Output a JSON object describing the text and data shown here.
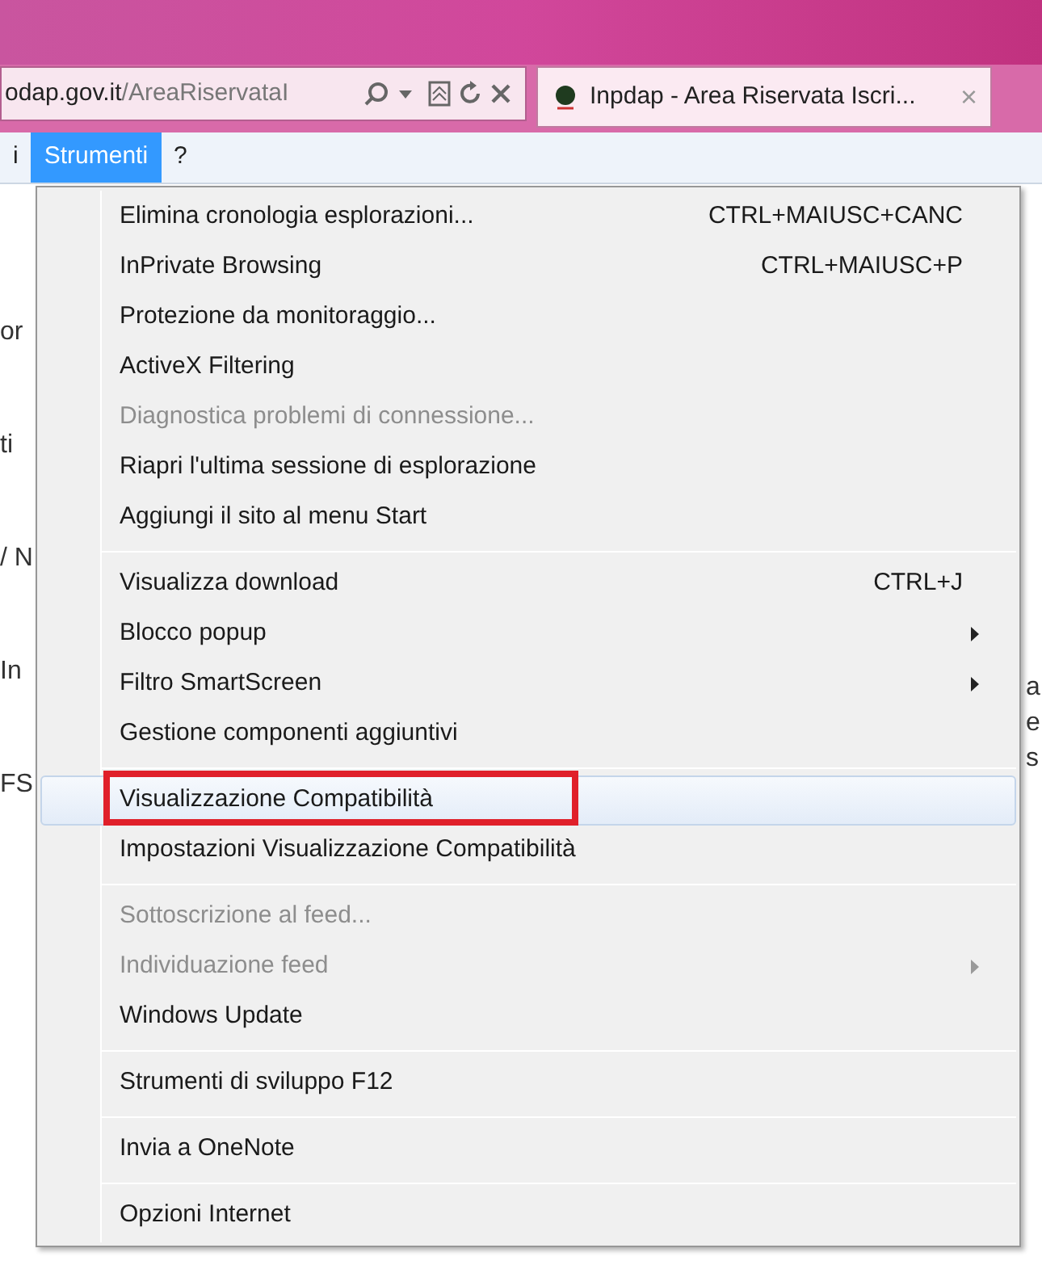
{
  "address_bar": {
    "host": "odap.gov.it",
    "path": "/AreaRiservataI"
  },
  "tab": {
    "title": "Inpdap - Area Riservata Iscri...",
    "close": "×"
  },
  "menubar": [
    {
      "label": "i",
      "selected": false
    },
    {
      "label": "Strumenti",
      "selected": true
    },
    {
      "label": "?",
      "selected": false
    }
  ],
  "page_fragments_left": [
    "or",
    "ti",
    "/ N",
    "In",
    "FS"
  ],
  "page_fragments_right": [
    "a",
    "e",
    "s"
  ],
  "menu": [
    {
      "kind": "item",
      "label": "Elimina cronologia esplorazioni...",
      "shortcut": "CTRL+MAIUSC+CANC",
      "disabled": false,
      "submenu": false,
      "selected": false,
      "annotated": false
    },
    {
      "kind": "item",
      "label": "InPrivate Browsing",
      "shortcut": "CTRL+MAIUSC+P",
      "disabled": false,
      "submenu": false,
      "selected": false,
      "annotated": false
    },
    {
      "kind": "item",
      "label": "Protezione da monitoraggio...",
      "disabled": false,
      "submenu": false,
      "selected": false,
      "annotated": false
    },
    {
      "kind": "item",
      "label": "ActiveX Filtering",
      "disabled": false,
      "submenu": false,
      "selected": false,
      "annotated": false
    },
    {
      "kind": "item",
      "label": "Diagnostica problemi di connessione...",
      "disabled": true,
      "submenu": false,
      "selected": false,
      "annotated": false
    },
    {
      "kind": "item",
      "label": "Riapri l'ultima sessione di esplorazione",
      "disabled": false,
      "submenu": false,
      "selected": false,
      "annotated": false
    },
    {
      "kind": "item",
      "label": "Aggiungi il sito al menu Start",
      "disabled": false,
      "submenu": false,
      "selected": false,
      "annotated": false
    },
    {
      "kind": "separator"
    },
    {
      "kind": "item",
      "label": "Visualizza download",
      "shortcut": "CTRL+J",
      "disabled": false,
      "submenu": false,
      "selected": false,
      "annotated": false
    },
    {
      "kind": "item",
      "label": "Blocco popup",
      "disabled": false,
      "submenu": true,
      "selected": false,
      "annotated": false
    },
    {
      "kind": "item",
      "label": "Filtro SmartScreen",
      "disabled": false,
      "submenu": true,
      "selected": false,
      "annotated": false
    },
    {
      "kind": "item",
      "label": "Gestione componenti aggiuntivi",
      "disabled": false,
      "submenu": false,
      "selected": false,
      "annotated": false
    },
    {
      "kind": "separator"
    },
    {
      "kind": "item",
      "label": "Visualizzazione Compatibilità",
      "disabled": false,
      "submenu": false,
      "selected": true,
      "annotated": true
    },
    {
      "kind": "item",
      "label": "Impostazioni Visualizzazione Compatibilità",
      "disabled": false,
      "submenu": false,
      "selected": false,
      "annotated": false
    },
    {
      "kind": "separator"
    },
    {
      "kind": "item",
      "label": "Sottoscrizione al feed...",
      "disabled": true,
      "submenu": false,
      "selected": false,
      "annotated": false
    },
    {
      "kind": "item",
      "label": "Individuazione feed",
      "disabled": true,
      "submenu": true,
      "selected": false,
      "annotated": false
    },
    {
      "kind": "item",
      "label": "Windows Update",
      "disabled": false,
      "submenu": false,
      "selected": false,
      "annotated": false
    },
    {
      "kind": "separator"
    },
    {
      "kind": "item",
      "label": "Strumenti di sviluppo F12",
      "disabled": false,
      "submenu": false,
      "selected": false,
      "annotated": false
    },
    {
      "kind": "separator"
    },
    {
      "kind": "item",
      "label": "Invia a OneNote",
      "disabled": false,
      "submenu": false,
      "selected": false,
      "annotated": false
    },
    {
      "kind": "separator"
    },
    {
      "kind": "item",
      "label": "Opzioni Internet",
      "disabled": false,
      "submenu": false,
      "selected": false,
      "annotated": false
    }
  ]
}
